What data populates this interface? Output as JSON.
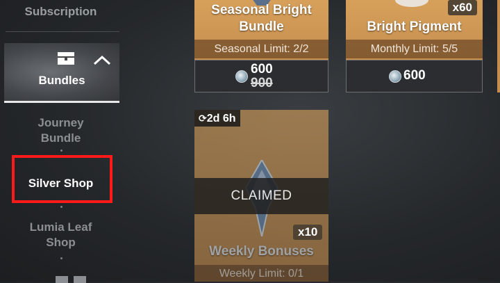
{
  "sidebar": {
    "items": [
      {
        "label": "Subscription"
      },
      {
        "label": "Bundles"
      },
      {
        "label": "Journey\nBundle"
      },
      {
        "label": "Silver Shop"
      },
      {
        "label": "Lumia Leaf\nShop"
      }
    ]
  },
  "cards": [
    {
      "title": "Seasonal Bright\nBundle",
      "limit": "Seasonal Limit: 2/2",
      "price": "600",
      "old_price": "900"
    },
    {
      "title": "Bright Pigment",
      "limit": "Monthly Limit: 5/5",
      "price": "600",
      "quantity": "x60"
    },
    {
      "title": "Weekly Bonuses",
      "limit": "Weekly Limit: 0/1",
      "quantity": "x10",
      "timer": "2d 6h",
      "status": "CLAIMED"
    }
  ],
  "colors": {
    "highlight": "#ff1a1a",
    "card_gold": "#d7a05a"
  }
}
